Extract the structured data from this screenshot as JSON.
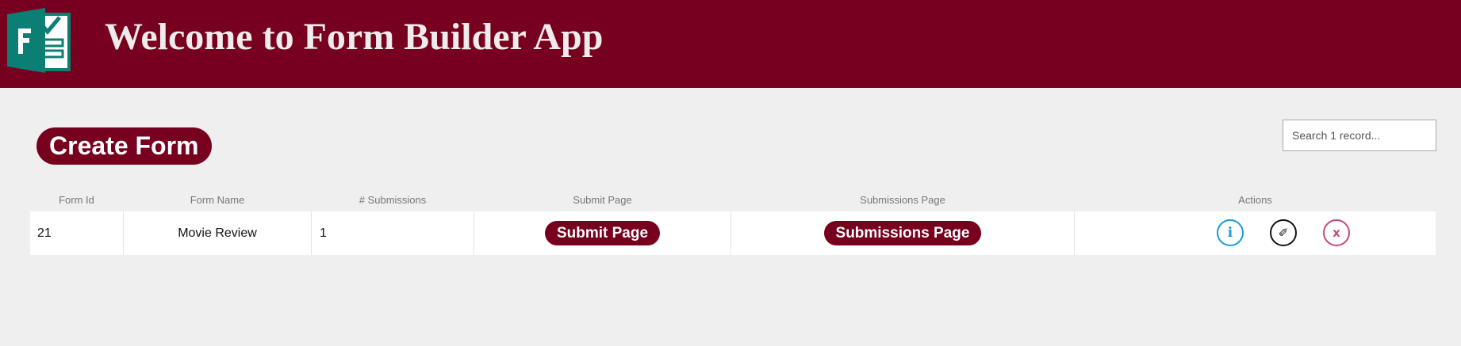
{
  "header": {
    "title": "Welcome to Form Builder App",
    "logo_icon": "forms-logo-icon",
    "background_color": "#77001e",
    "logo_color": "#0b7f73"
  },
  "toolbar": {
    "create_form_label": "Create Form"
  },
  "search": {
    "placeholder": "Search 1 record...",
    "value": ""
  },
  "table": {
    "columns": [
      "Form Id",
      "Form Name",
      "# Submissions",
      "Submit Page",
      "Submissions Page",
      "Actions"
    ],
    "rows": [
      {
        "form_id": "21",
        "form_name": "Movie Review",
        "submissions": "1",
        "submit_page_label": "Submit Page",
        "submissions_page_label": "Submissions Page",
        "actions": {
          "info_glyph": "ℹ",
          "edit_glyph": "✐",
          "delete_glyph": "x"
        }
      }
    ]
  },
  "colors": {
    "accent": "#77001e",
    "info": "#1a9ad6",
    "edit": "#111111",
    "delete": "#c24a7c"
  }
}
